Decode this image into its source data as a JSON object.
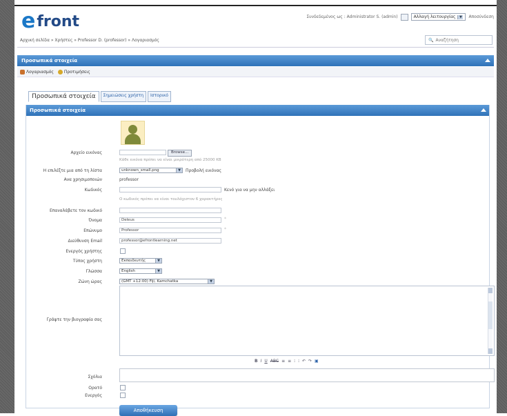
{
  "header": {
    "logo_text": "front",
    "logo_e": "e",
    "user_text": "Συνδεδεμένος ως : Administrator S. (admin)",
    "role_select": "Αλλαγή λειτουργίας",
    "logout": "Αποσύνδεση"
  },
  "breadcrumb": "Αρχική σελίδα » Χρήστες » Professor D. (professor) » Λογαριασμός",
  "search": {
    "placeholder": "Αναζήτηση"
  },
  "panel": {
    "title": "Προσωπικά στοιχεία",
    "toolbar": [
      "Λογαριασμός",
      "Προτιμήσεις"
    ]
  },
  "tabs": [
    "Προσωπικά στοιχεία",
    "Σημειώσεις χρήστη",
    "Ιστορικό"
  ],
  "inner_panel_title": "Προσωπικά στοιχεία",
  "form": {
    "avatar_file_label": "Αρχείο εικόνας",
    "browse_label": "Browse...",
    "avatar_hint": "Κάθε εικόνα πρέπει να είναι μικρότερη από 25000 KB",
    "avatar_list_label": "Η επιλέξτε μια από τη λίστα",
    "avatar_list_value": "unknown_small.png",
    "avatar_preview_link": "Προβολή εικόνας",
    "login_label": "Ανα χρησιμοποιών",
    "login_value": "professor",
    "password_label": "Κωδικός",
    "password_side": "Κενό για να μην αλλάξει",
    "password_hint": "Ο κωδικός πρέπει να είναι τουλάχιστον 6 χαρακτήρες",
    "repeat_label": "Επαναλάβετε τον κωδικό",
    "name_label": "Όνομα",
    "name_value": "Deleus",
    "surname_label": "Επώνυμο",
    "surname_value": "Professor",
    "email_label": "Διεύθυνση Email",
    "email_value": "professor@efrontlearning.net",
    "active_label": "Ενεργός χρήστης",
    "type_label": "Τύπος χρήστη",
    "type_value": "Εκπαιδευτής",
    "lang_label": "Γλώσσα",
    "lang_value": "English",
    "tz_label": "Ζώνη ώρας",
    "tz_value": "(GMT +12:00) Fiji, Kamchatka",
    "bio_label": "Γράψτε την βιογραφία σας",
    "editor_tools": [
      "B",
      "I",
      "U",
      "ABC",
      "≡",
      "≡",
      "⁝",
      "⁝",
      "↶",
      "↷",
      "▣"
    ],
    "comments_label": "Σχόλια",
    "visible_label": "Ορατό",
    "active2_label": "Ενεργός",
    "submit_label": "Αποθήκευση"
  }
}
